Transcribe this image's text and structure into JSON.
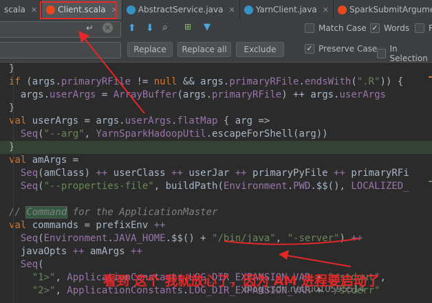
{
  "tabs": [
    {
      "label": "scala",
      "icon": "scala-file-icon",
      "color": "#ff5500",
      "active": false
    },
    {
      "label": "Client.scala",
      "icon": "scala-file-icon",
      "color": "#e8481c",
      "active": true
    },
    {
      "label": "AbstractService.java",
      "icon": "java-class-icon",
      "color": "#3592c4",
      "active": false
    },
    {
      "label": "YarnClient.java",
      "icon": "java-class-icon",
      "color": "#3592c4",
      "active": false
    },
    {
      "label": "SparkSubmitArguments.",
      "icon": "scala-class-icon",
      "color": "#e8481c",
      "active": false
    }
  ],
  "find": {
    "replace_label": "Replace",
    "replace_all_label": "Replace all",
    "exclude_label": "Exclude",
    "match_case_label": "Match Case",
    "match_case_checked": false,
    "words_label": "Words",
    "words_checked": true,
    "regex_label": "R",
    "regex_checked": false,
    "preserve_case_label": "Preserve Case",
    "preserve_case_checked": true,
    "in_selection_label": "In Selection",
    "in_selection_checked": false
  },
  "code_lines": [
    [
      {
        "t": "}",
        "c": "plain"
      }
    ],
    [
      {
        "t": "if ",
        "c": "kw"
      },
      {
        "t": "(args.",
        "c": "plain"
      },
      {
        "t": "primaryRFile",
        "c": "field"
      },
      {
        "t": " != ",
        "c": "plain"
      },
      {
        "t": "null",
        "c": "kw"
      },
      {
        "t": " && args.",
        "c": "plain"
      },
      {
        "t": "primaryRFile",
        "c": "field"
      },
      {
        "t": ".",
        "c": "plain"
      },
      {
        "t": "endsWith",
        "c": "field"
      },
      {
        "t": "(",
        "c": "plain"
      },
      {
        "t": "\".R\"",
        "c": "str"
      },
      {
        "t": ")) {",
        "c": "plain"
      }
    ],
    [
      {
        "t": "  args.",
        "c": "plain"
      },
      {
        "t": "userArgs",
        "c": "field"
      },
      {
        "t": " = ",
        "c": "plain"
      },
      {
        "t": "ArrayBuffer",
        "c": "field"
      },
      {
        "t": "(args.",
        "c": "plain"
      },
      {
        "t": "primaryRFile",
        "c": "field"
      },
      {
        "t": ") ++ args.",
        "c": "plain"
      },
      {
        "t": "userArgs",
        "c": "field"
      }
    ],
    [
      {
        "t": "}",
        "c": "plain"
      }
    ],
    [
      {
        "t": "val ",
        "c": "kw"
      },
      {
        "t": "userArgs = args.",
        "c": "plain"
      },
      {
        "t": "userArgs",
        "c": "field"
      },
      {
        "t": ".",
        "c": "plain"
      },
      {
        "t": "flatMap",
        "c": "field"
      },
      {
        "t": " { arg =>",
        "c": "plain"
      }
    ],
    [
      {
        "t": "  ",
        "c": "plain"
      },
      {
        "t": "Seq",
        "c": "field"
      },
      {
        "t": "(",
        "c": "plain"
      },
      {
        "t": "\"--arg\"",
        "c": "str"
      },
      {
        "t": ", ",
        "c": "plain"
      },
      {
        "t": "YarnSparkHadoopUtil",
        "c": "field"
      },
      {
        "t": ".escapeForShell(arg))",
        "c": "plain"
      }
    ],
    [
      {
        "t": "}",
        "c": "plain"
      }
    ],
    [
      {
        "t": "val ",
        "c": "kw"
      },
      {
        "t": "amArgs =",
        "c": "plain"
      }
    ],
    [
      {
        "t": "  ",
        "c": "plain"
      },
      {
        "t": "Seq",
        "c": "field"
      },
      {
        "t": "(amClass) ",
        "c": "plain"
      },
      {
        "t": "++",
        "c": "field"
      },
      {
        "t": " userClass ",
        "c": "plain"
      },
      {
        "t": "++",
        "c": "field"
      },
      {
        "t": " userJar ",
        "c": "plain"
      },
      {
        "t": "++",
        "c": "field"
      },
      {
        "t": " primaryPyFile ",
        "c": "plain"
      },
      {
        "t": "++",
        "c": "field"
      },
      {
        "t": " primaryRFi",
        "c": "plain"
      }
    ],
    [
      {
        "t": "  ",
        "c": "plain"
      },
      {
        "t": "Seq",
        "c": "field"
      },
      {
        "t": "(",
        "c": "plain"
      },
      {
        "t": "\"--properties-file\"",
        "c": "str"
      },
      {
        "t": ", buildPath(",
        "c": "plain"
      },
      {
        "t": "Environment",
        "c": "field"
      },
      {
        "t": ".",
        "c": "plain"
      },
      {
        "t": "PWD",
        "c": "field"
      },
      {
        "t": ".$$(), ",
        "c": "plain"
      },
      {
        "t": "LOCALIZED_",
        "c": "field"
      }
    ],
    [
      {
        "t": "",
        "c": "plain"
      }
    ],
    [
      {
        "t": "// ",
        "c": "comment"
      },
      {
        "t": "Command",
        "c": "commenthl"
      },
      {
        "t": " for the ApplicationMaster",
        "c": "comment"
      }
    ],
    [
      {
        "t": "val ",
        "c": "kw"
      },
      {
        "t": "commands = prefixEnv ",
        "c": "plain"
      },
      {
        "t": "++",
        "c": "field"
      }
    ],
    [
      {
        "t": "  ",
        "c": "plain"
      },
      {
        "t": "Seq",
        "c": "field"
      },
      {
        "t": "(",
        "c": "plain"
      },
      {
        "t": "Environment",
        "c": "field"
      },
      {
        "t": ".",
        "c": "plain"
      },
      {
        "t": "JAVA_HOME",
        "c": "field"
      },
      {
        "t": ".$$() + ",
        "c": "plain"
      },
      {
        "t": "\"/bin/java\"",
        "c": "str"
      },
      {
        "t": ", ",
        "c": "plain"
      },
      {
        "t": "\"-server\"",
        "c": "str"
      },
      {
        "t": ") ",
        "c": "plain"
      },
      {
        "t": "++",
        "c": "field"
      }
    ],
    [
      {
        "t": "  javaOpts ",
        "c": "plain"
      },
      {
        "t": "++",
        "c": "field"
      },
      {
        "t": " amArgs ",
        "c": "plain"
      },
      {
        "t": "++",
        "c": "field"
      }
    ],
    [
      {
        "t": "  ",
        "c": "plain"
      },
      {
        "t": "Seq",
        "c": "field"
      },
      {
        "t": "(",
        "c": "plain"
      }
    ],
    [
      {
        "t": "    ",
        "c": "plain"
      },
      {
        "t": "\"1>\"",
        "c": "str"
      },
      {
        "t": ", ",
        "c": "plain"
      },
      {
        "t": "ApplicationConstants",
        "c": "field"
      },
      {
        "t": ".",
        "c": "plain"
      },
      {
        "t": "LOG_DIR_EXPANSION_VAR",
        "c": "field"
      },
      {
        "t": " + ",
        "c": "plain"
      },
      {
        "t": "\"/stdout\"",
        "c": "str"
      },
      {
        "t": ",",
        "c": "plain"
      }
    ],
    [
      {
        "t": "    ",
        "c": "plain"
      },
      {
        "t": "\"2>\"",
        "c": "str"
      },
      {
        "t": ", ",
        "c": "plain"
      },
      {
        "t": "ApplicationConstants",
        "c": "field"
      },
      {
        "t": ".",
        "c": "plain"
      },
      {
        "t": "LOG_DIR_EXPANSION_VAR",
        "c": "field"
      },
      {
        "t": " + ",
        "c": "plain"
      },
      {
        "t": "\"/stderr\"",
        "c": "str"
      }
    ]
  ],
  "caption": "看到 这个 我就放心了，因为 AM 进程要启动了",
  "watermark": "blog.csdn.net/u010595514",
  "colors": {
    "annotation_red": "#e52727",
    "keyword": "#cc7832",
    "field": "#9876aa",
    "string": "#6a8759",
    "comment": "#808080"
  }
}
